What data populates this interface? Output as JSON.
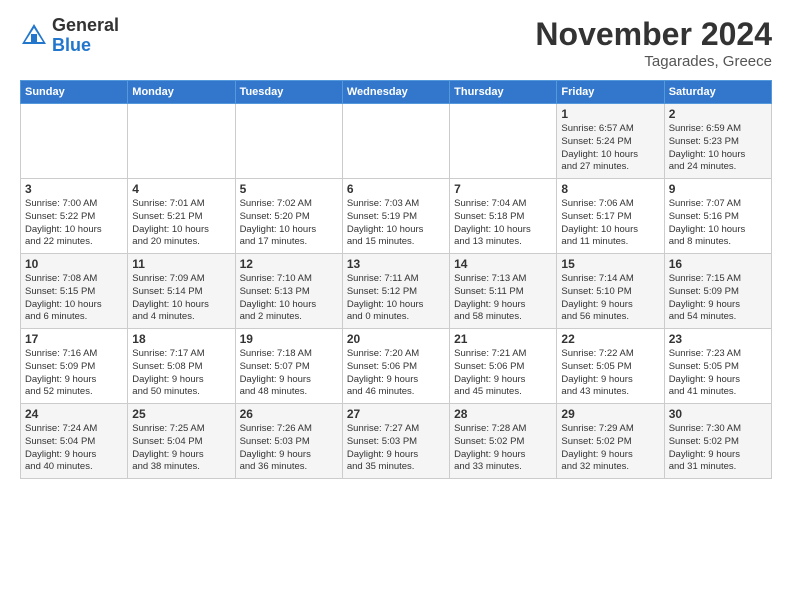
{
  "header": {
    "logo_general": "General",
    "logo_blue": "Blue",
    "month": "November 2024",
    "location": "Tagarades, Greece"
  },
  "weekdays": [
    "Sunday",
    "Monday",
    "Tuesday",
    "Wednesday",
    "Thursday",
    "Friday",
    "Saturday"
  ],
  "weeks": [
    [
      {
        "day": "",
        "info": ""
      },
      {
        "day": "",
        "info": ""
      },
      {
        "day": "",
        "info": ""
      },
      {
        "day": "",
        "info": ""
      },
      {
        "day": "",
        "info": ""
      },
      {
        "day": "1",
        "info": "Sunrise: 6:57 AM\nSunset: 5:24 PM\nDaylight: 10 hours\nand 27 minutes."
      },
      {
        "day": "2",
        "info": "Sunrise: 6:59 AM\nSunset: 5:23 PM\nDaylight: 10 hours\nand 24 minutes."
      }
    ],
    [
      {
        "day": "3",
        "info": "Sunrise: 7:00 AM\nSunset: 5:22 PM\nDaylight: 10 hours\nand 22 minutes."
      },
      {
        "day": "4",
        "info": "Sunrise: 7:01 AM\nSunset: 5:21 PM\nDaylight: 10 hours\nand 20 minutes."
      },
      {
        "day": "5",
        "info": "Sunrise: 7:02 AM\nSunset: 5:20 PM\nDaylight: 10 hours\nand 17 minutes."
      },
      {
        "day": "6",
        "info": "Sunrise: 7:03 AM\nSunset: 5:19 PM\nDaylight: 10 hours\nand 15 minutes."
      },
      {
        "day": "7",
        "info": "Sunrise: 7:04 AM\nSunset: 5:18 PM\nDaylight: 10 hours\nand 13 minutes."
      },
      {
        "day": "8",
        "info": "Sunrise: 7:06 AM\nSunset: 5:17 PM\nDaylight: 10 hours\nand 11 minutes."
      },
      {
        "day": "9",
        "info": "Sunrise: 7:07 AM\nSunset: 5:16 PM\nDaylight: 10 hours\nand 8 minutes."
      }
    ],
    [
      {
        "day": "10",
        "info": "Sunrise: 7:08 AM\nSunset: 5:15 PM\nDaylight: 10 hours\nand 6 minutes."
      },
      {
        "day": "11",
        "info": "Sunrise: 7:09 AM\nSunset: 5:14 PM\nDaylight: 10 hours\nand 4 minutes."
      },
      {
        "day": "12",
        "info": "Sunrise: 7:10 AM\nSunset: 5:13 PM\nDaylight: 10 hours\nand 2 minutes."
      },
      {
        "day": "13",
        "info": "Sunrise: 7:11 AM\nSunset: 5:12 PM\nDaylight: 10 hours\nand 0 minutes."
      },
      {
        "day": "14",
        "info": "Sunrise: 7:13 AM\nSunset: 5:11 PM\nDaylight: 9 hours\nand 58 minutes."
      },
      {
        "day": "15",
        "info": "Sunrise: 7:14 AM\nSunset: 5:10 PM\nDaylight: 9 hours\nand 56 minutes."
      },
      {
        "day": "16",
        "info": "Sunrise: 7:15 AM\nSunset: 5:09 PM\nDaylight: 9 hours\nand 54 minutes."
      }
    ],
    [
      {
        "day": "17",
        "info": "Sunrise: 7:16 AM\nSunset: 5:09 PM\nDaylight: 9 hours\nand 52 minutes."
      },
      {
        "day": "18",
        "info": "Sunrise: 7:17 AM\nSunset: 5:08 PM\nDaylight: 9 hours\nand 50 minutes."
      },
      {
        "day": "19",
        "info": "Sunrise: 7:18 AM\nSunset: 5:07 PM\nDaylight: 9 hours\nand 48 minutes."
      },
      {
        "day": "20",
        "info": "Sunrise: 7:20 AM\nSunset: 5:06 PM\nDaylight: 9 hours\nand 46 minutes."
      },
      {
        "day": "21",
        "info": "Sunrise: 7:21 AM\nSunset: 5:06 PM\nDaylight: 9 hours\nand 45 minutes."
      },
      {
        "day": "22",
        "info": "Sunrise: 7:22 AM\nSunset: 5:05 PM\nDaylight: 9 hours\nand 43 minutes."
      },
      {
        "day": "23",
        "info": "Sunrise: 7:23 AM\nSunset: 5:05 PM\nDaylight: 9 hours\nand 41 minutes."
      }
    ],
    [
      {
        "day": "24",
        "info": "Sunrise: 7:24 AM\nSunset: 5:04 PM\nDaylight: 9 hours\nand 40 minutes."
      },
      {
        "day": "25",
        "info": "Sunrise: 7:25 AM\nSunset: 5:04 PM\nDaylight: 9 hours\nand 38 minutes."
      },
      {
        "day": "26",
        "info": "Sunrise: 7:26 AM\nSunset: 5:03 PM\nDaylight: 9 hours\nand 36 minutes."
      },
      {
        "day": "27",
        "info": "Sunrise: 7:27 AM\nSunset: 5:03 PM\nDaylight: 9 hours\nand 35 minutes."
      },
      {
        "day": "28",
        "info": "Sunrise: 7:28 AM\nSunset: 5:02 PM\nDaylight: 9 hours\nand 33 minutes."
      },
      {
        "day": "29",
        "info": "Sunrise: 7:29 AM\nSunset: 5:02 PM\nDaylight: 9 hours\nand 32 minutes."
      },
      {
        "day": "30",
        "info": "Sunrise: 7:30 AM\nSunset: 5:02 PM\nDaylight: 9 hours\nand 31 minutes."
      }
    ]
  ]
}
